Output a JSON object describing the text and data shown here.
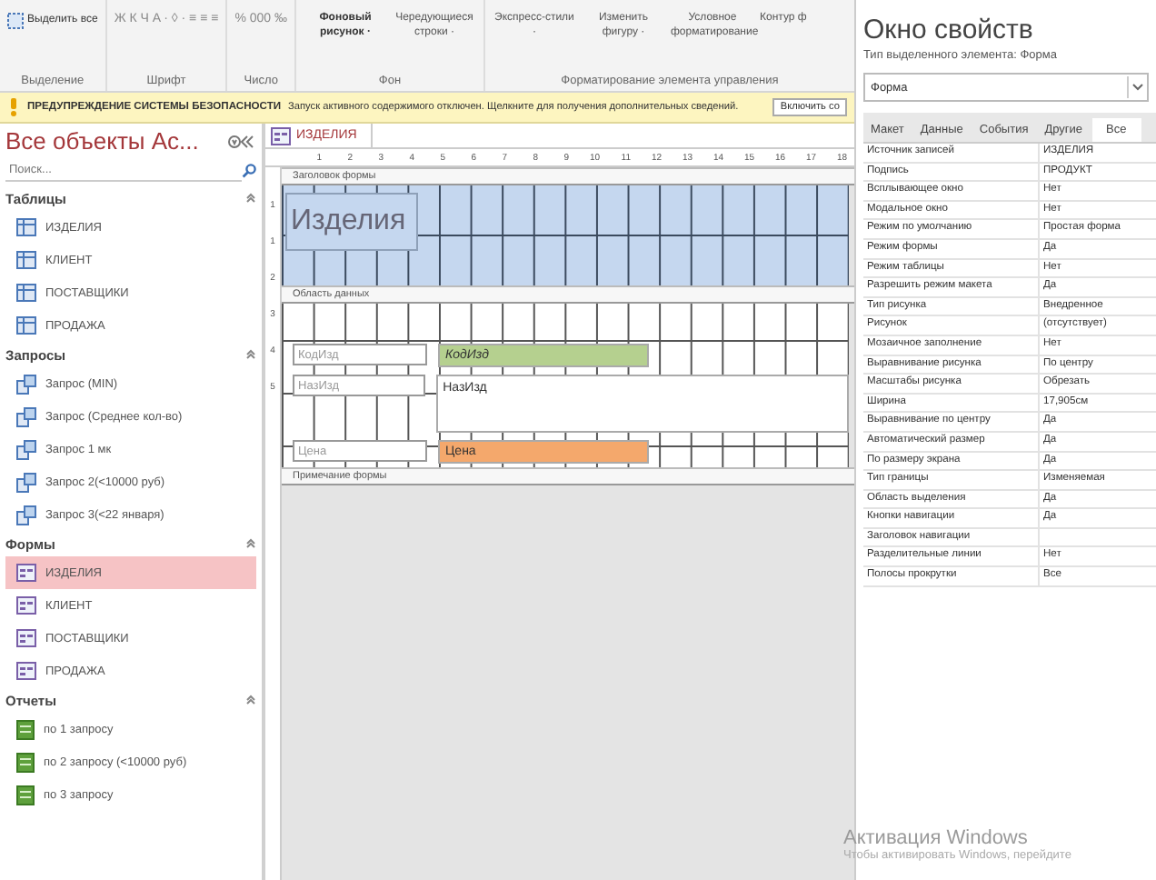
{
  "ribbon": {
    "groups": [
      {
        "label": "Выделение",
        "items": [
          {
            "kind": "select",
            "text": "Выделить все"
          }
        ]
      },
      {
        "label": "Шрифт",
        "items": [
          {
            "kind": "glyphs",
            "text": "Ж  К  Ч   A ·  ◊ ·  ≡ ≡ ≡"
          }
        ]
      },
      {
        "label": "Число",
        "items": [
          {
            "kind": "glyphs",
            "text": "% 000 ‰"
          }
        ]
      },
      {
        "label": "Фон",
        "items": [
          {
            "kind": "bold",
            "text": "Фоновый рисунок ·"
          },
          {
            "kind": "plain",
            "text": "Чередующиеся строки ·"
          }
        ]
      },
      {
        "label": "Форматирование элемента управления",
        "items": [
          {
            "kind": "plain",
            "text": "Экспресс-стили ·"
          },
          {
            "kind": "plain",
            "text": "Изменить фигуру ·"
          },
          {
            "kind": "plain",
            "text": "Условное форматирование"
          },
          {
            "kind": "stack",
            "text": "Контур ф"
          }
        ]
      }
    ]
  },
  "warning": {
    "title": "ПРЕДУПРЕЖДЕНИЕ СИСТЕМЫ БЕЗОПАСНОСТИ",
    "message": "Запуск активного содержимого отключен. Щелкните для получения дополнительных сведений.",
    "button": "Включить со"
  },
  "nav": {
    "title": "Все объекты Ac...",
    "search_placeholder": "Поиск...",
    "groups": [
      {
        "label": "Таблицы",
        "kind": "table",
        "items": [
          {
            "label": "ИЗДЕЛИЯ",
            "selected": false
          },
          {
            "label": "КЛИЕНТ",
            "selected": false
          },
          {
            "label": "ПОСТАВЩИКИ",
            "selected": false
          },
          {
            "label": "ПРОДАЖА",
            "selected": false
          }
        ]
      },
      {
        "label": "Запросы",
        "kind": "query",
        "items": [
          {
            "label": "Запрос (MIN)",
            "selected": false
          },
          {
            "label": "Запрос (Среднее кол-во)",
            "selected": false
          },
          {
            "label": "Запрос 1 мк",
            "selected": false
          },
          {
            "label": "Запрос 2(<10000 руб)",
            "selected": false
          },
          {
            "label": "Запрос 3(<22 января)",
            "selected": false
          }
        ]
      },
      {
        "label": "Формы",
        "kind": "form",
        "items": [
          {
            "label": "ИЗДЕЛИЯ",
            "selected": true
          },
          {
            "label": "КЛИЕНТ",
            "selected": false
          },
          {
            "label": "ПОСТАВЩИКИ",
            "selected": false
          },
          {
            "label": "ПРОДАЖА",
            "selected": false
          }
        ]
      },
      {
        "label": "Отчеты",
        "kind": "report",
        "items": [
          {
            "label": "по 1 запросу",
            "selected": false
          },
          {
            "label": "по 2 запросу (<10000 руб)",
            "selected": false
          },
          {
            "label": "по 3 запросу",
            "selected": false
          }
        ]
      }
    ]
  },
  "designer": {
    "tab": "ИЗДЕЛИЯ",
    "ruler": [
      "1",
      "2",
      "3",
      "4",
      "5",
      "6",
      "7",
      "8",
      "9",
      "10",
      "11",
      "12",
      "13",
      "14",
      "15",
      "16",
      "17",
      "18"
    ],
    "vruler": [
      "1",
      "1",
      "2",
      "3",
      "4",
      "5"
    ],
    "header_section": "Заголовок формы",
    "header_label": "Изделия",
    "data_section": "Область данных",
    "footer_section": "Примечание формы",
    "controls": [
      {
        "label": "КодИзд",
        "field": "КодИзд",
        "color": "#b5d08f",
        "tall": false
      },
      {
        "label": "НазИзд",
        "field": "НазИзд",
        "color": "#ffffff",
        "tall": true
      },
      {
        "label": "Цена",
        "field": "Цена",
        "color": "#f4a86c",
        "tall": false
      }
    ]
  },
  "properties": {
    "title": "Окно свойств",
    "subtitle": "Тип выделенного элемента:  Форма",
    "object": "Форма",
    "tabs": [
      {
        "label": "Макет",
        "selected": false
      },
      {
        "label": "Данные",
        "selected": false
      },
      {
        "label": "События",
        "selected": false
      },
      {
        "label": "Другие",
        "selected": false
      },
      {
        "label": "Все",
        "selected": true
      }
    ],
    "rows": [
      {
        "name": "Источник записей",
        "value": "ИЗДЕЛИЯ"
      },
      {
        "name": "Подпись",
        "value": "ПРОДУКТ"
      },
      {
        "name": "Всплывающее окно",
        "value": "Нет"
      },
      {
        "name": "Модальное окно",
        "value": "Нет"
      },
      {
        "name": "Режим по умолчанию",
        "value": "Простая форма"
      },
      {
        "name": "Режим формы",
        "value": "Да"
      },
      {
        "name": "Режим таблицы",
        "value": "Нет"
      },
      {
        "name": "Разрешить режим макета",
        "value": "Да"
      },
      {
        "name": "Тип рисунка",
        "value": "Внедренное"
      },
      {
        "name": "Рисунок",
        "value": "(отсутствует)"
      },
      {
        "name": "Мозаичное заполнение",
        "value": "Нет"
      },
      {
        "name": "Выравнивание рисунка",
        "value": "По центру"
      },
      {
        "name": "Масштабы рисунка",
        "value": "Обрезать"
      },
      {
        "name": "Ширина",
        "value": "17,905см"
      },
      {
        "name": "Выравнивание по центру",
        "value": "Да"
      },
      {
        "name": "Автоматический размер",
        "value": "Да"
      },
      {
        "name": "По размеру экрана",
        "value": "Да"
      },
      {
        "name": "Тип границы",
        "value": "Изменяемая"
      },
      {
        "name": "Область выделения",
        "value": "Да"
      },
      {
        "name": "Кнопки навигации",
        "value": "Да"
      },
      {
        "name": "Заголовок навигации"
      },
      {
        "name": "Разделительные линии",
        "value": "Нет"
      },
      {
        "name": "Полосы прокрутки",
        "value": "Все"
      }
    ]
  },
  "activation": {
    "title": "Активация Windows",
    "message": "Чтобы активировать Windows, перейдите"
  }
}
